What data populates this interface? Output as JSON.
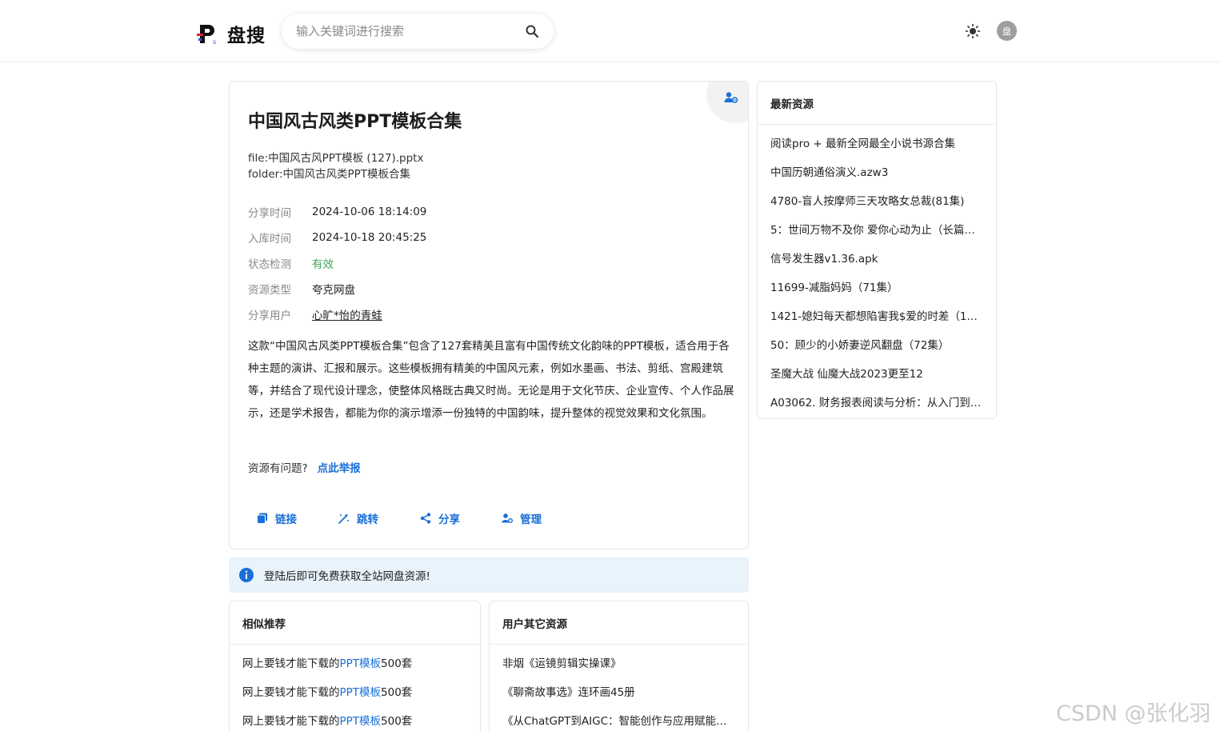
{
  "header": {
    "logo_text": "盘搜",
    "search_placeholder": "输入关键词进行搜索",
    "avatar_text": "盘"
  },
  "resource": {
    "title": "中国风古风类PPT模板合集",
    "file_line": "file:中国风古风PPT模板 (127).pptx",
    "folder_line": "folder:中国风古风类PPT模板合集",
    "meta": [
      {
        "label": "分享时间",
        "value": "2024-10-06 18:14:09"
      },
      {
        "label": "入库时间",
        "value": "2024-10-18 20:45:25"
      },
      {
        "label": "状态检测",
        "value": "有效"
      },
      {
        "label": "资源类型",
        "value": "夸克网盘"
      },
      {
        "label": "分享用户",
        "value": "心旷*怡的青蛙"
      }
    ],
    "description": "这款“中国风古风类PPT模板合集”包含了127套精美且富有中国传统文化韵味的PPT模板，适合用于各种主题的演讲、汇报和展示。这些模板拥有精美的中国风元素，例如水墨画、书法、剪纸、宫殿建筑等，并结合了现代设计理念，使整体风格既古典又时尚。无论是用于文化节庆、企业宣传、个人作品展示，还是学术报告，都能为你的演示增添一份独特的中国韵味，提升整体的视觉效果和文化氛围。",
    "report_question": "资源有问题?",
    "report_link": "点此举报",
    "actions": {
      "link": "链接",
      "jump": "跳转",
      "share": "分享",
      "manage": "管理"
    }
  },
  "notice": "登陆后即可免费获取全站网盘资源!",
  "latest": {
    "title": "最新资源",
    "items": [
      "阅读pro + 最新全网最全小说书源合集",
      "中国历朝通俗演义.azw3",
      "4780-盲人按摩师三天攻略女总裁(81集)",
      "5：世间万物不及你 爱你心动为止（长篇…",
      "信号发生器v1.36.apk",
      "11699-减脂妈妈（71集）",
      "1421-媳妇每天都想陷害我$爱的时差（10…",
      "50：顾少的小娇妻逆风翻盘（72集）",
      "圣魔大战 仙魔大战2023更至12",
      "A03062. 财务报表阅读与分析：从入门到…"
    ]
  },
  "similar": {
    "title": "相似推荐",
    "items": [
      {
        "pre": "网上要钱才能下载的",
        "hl": "PPT模板",
        "post": "500套"
      },
      {
        "pre": "网上要钱才能下载的",
        "hl": "PPT模板",
        "post": "500套"
      },
      {
        "pre": "网上要钱才能下载的",
        "hl": "PPT模板",
        "post": "500套"
      }
    ]
  },
  "user_other": {
    "title": "用户其它资源",
    "items": [
      "非烟《运镜剪辑实操课》",
      "《聊斋故事选》连环画45册",
      "《从ChatGPT到AIGC：智能创作与应用赋能》…"
    ]
  },
  "watermark": "CSDN @张化羽",
  "colors": {
    "accent": "#1a6fd8",
    "valid": "#3ba55c",
    "notice_bg": "#e8f3fc"
  }
}
